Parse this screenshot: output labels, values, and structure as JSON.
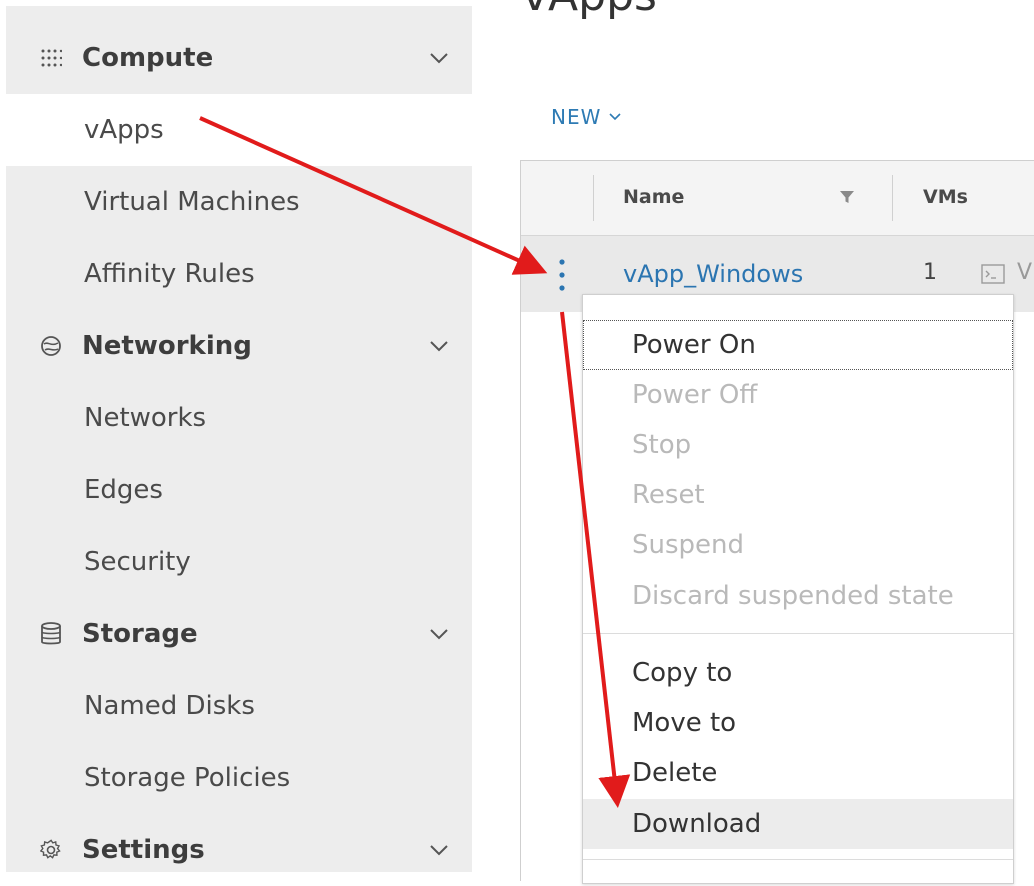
{
  "page": {
    "title": "vApps"
  },
  "sidebar": {
    "sections": [
      {
        "label": "Compute",
        "icon": "grid-dots-icon",
        "children": [
          "vApps",
          "Virtual Machines",
          "Affinity Rules"
        ]
      },
      {
        "label": "Networking",
        "icon": "network-globe-icon",
        "children": [
          "Networks",
          "Edges",
          "Security"
        ]
      },
      {
        "label": "Storage",
        "icon": "database-icon",
        "children": [
          "Named Disks",
          "Storage Policies"
        ]
      },
      {
        "label": "Settings",
        "icon": "gear-icon",
        "children": []
      }
    ],
    "active": "vApps"
  },
  "toolbar": {
    "new_label": "NEW"
  },
  "grid": {
    "columns": [
      "Name",
      "VMs"
    ],
    "rows": [
      {
        "name": "vApp_Windows",
        "vms": "1",
        "extra": "V"
      }
    ]
  },
  "context_menu": {
    "items": [
      {
        "label": "Power On",
        "disabled": false
      },
      {
        "label": "Power Off",
        "disabled": true
      },
      {
        "label": "Stop",
        "disabled": true
      },
      {
        "label": "Reset",
        "disabled": true
      },
      {
        "label": "Suspend",
        "disabled": true
      },
      {
        "label": "Discard suspended state",
        "disabled": true
      },
      {
        "label": "Copy to",
        "disabled": false
      },
      {
        "label": "Move to",
        "disabled": false
      },
      {
        "label": "Delete",
        "disabled": false
      },
      {
        "label": "Download",
        "disabled": false
      }
    ]
  },
  "colors": {
    "link": "#2b75b1",
    "accent": "#2e7bb4",
    "annotation_arrow": "#e11b1b",
    "sidebar_bg": "#ededed"
  }
}
